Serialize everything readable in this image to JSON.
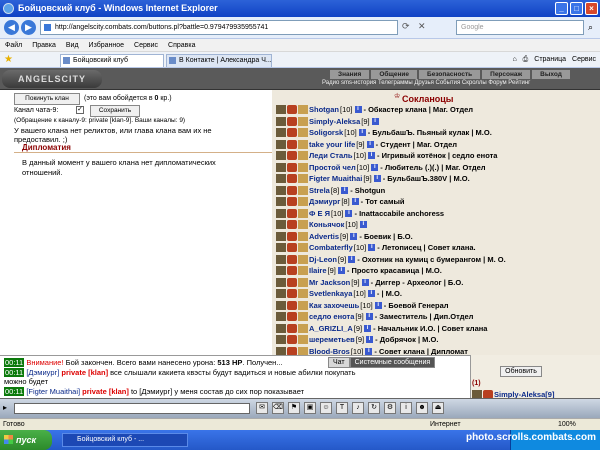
{
  "window": {
    "title": "Бойцовский клуб - Windows Internet Explorer"
  },
  "browser": {
    "url": "http://angelscity.combats.com/buttons.pl?battle=0.979479935955741",
    "search_placeholder": "Google",
    "menu": [
      "Файл",
      "Правка",
      "Вид",
      "Избранное",
      "Сервис",
      "Справка"
    ],
    "tabs": [
      {
        "label": "Бойцовский клуб"
      },
      {
        "label": "В Контакте | Александра Ч..."
      }
    ],
    "tools": [
      "Страница",
      "Сервис"
    ]
  },
  "game": {
    "logo": "ANGELSCITY",
    "menu_top": [
      "Знания",
      "Общение",
      "Безопасность",
      "Персонаж",
      "Выход"
    ],
    "menu_bottom": "Радио  sms-история  Телеграммы  Друзья  События  Скроллы  Форум  Рейтинг"
  },
  "left": {
    "leave_clan_button": "Покинуть клан",
    "cost_note_pre": "(это вам обойдется в",
    "cost_value": "0",
    "cost_note_post": "кр.)",
    "channel_label": "Канал чата-9:",
    "save_button": "Сохранить",
    "channel_hint": "(Обращение к каналу-9: private [klan-9]. Ваши каналы: 9)",
    "relics_text_1": "У вашего клана нет реликтов, или глава клана вам их не",
    "relics_text_2": "предоставил. ;)",
    "diplomacy_title": "Дипломатия",
    "diplomacy_text_1": "В данный момент у вашего клана нет дипломатических",
    "diplomacy_text_2": "отношений."
  },
  "clan": {
    "title": "Сокланоцы",
    "members": [
      {
        "name": "Shotgan",
        "level": "[10]",
        "role": "- Обкастер клана | Маг. Отдел"
      },
      {
        "name": "Simply-Aleksa",
        "level": "[9]",
        "role": ""
      },
      {
        "name": "Soligorsk",
        "level": "[10]",
        "role": "- БульбашЪ. Пьяный кулак | М.О."
      },
      {
        "name": "take your life",
        "level": "[9]",
        "role": "- Студент | Маг. Отдел"
      },
      {
        "name": "Леди Сталь",
        "level": "[10]",
        "role": "- Игривый котёнок | седло енота"
      },
      {
        "name": "Простой чел",
        "level": "[10]",
        "role": "- Любитель (.)(.) | Маг. Отдел"
      },
      {
        "name": "Figter Muaithai",
        "level": "[9]",
        "role": "- БульбашЪ.380V | М.О."
      },
      {
        "name": "Strela",
        "level": "[8]",
        "role": "- Shotgun"
      },
      {
        "name": "Дэмиург",
        "level": "[8]",
        "role": "- Тот самый"
      },
      {
        "name": "Ф Е Я",
        "level": "[10]",
        "role": "- Inattaccabile anchoress"
      },
      {
        "name": "Коньячок",
        "level": "[10]",
        "role": ""
      },
      {
        "name": "Advertis",
        "level": "[9]",
        "role": "- Боевик | Б.О."
      },
      {
        "name": "Combaterfly",
        "level": "[10]",
        "role": "- Летописец | Совет клана."
      },
      {
        "name": "Dj-Leon",
        "level": "[9]",
        "role": "- Охотник на кумиц с бумерангом | М. О."
      },
      {
        "name": "Ilaire",
        "level": "[9]",
        "role": "- Просто красавица | М.О."
      },
      {
        "name": "Mr Jackson",
        "level": "[9]",
        "role": "- Диггер - Археолог | Б.О."
      },
      {
        "name": "Svetlenkaya",
        "level": "[10]",
        "role": "- | М.О."
      },
      {
        "name": "Как захочешь",
        "level": "[10]",
        "role": "- Боевой Генерал"
      },
      {
        "name": "седло енота",
        "level": "[9]",
        "role": "- Заместитель | Дип.Отдел"
      },
      {
        "name": "A_GRIZLI_A",
        "level": "[9]",
        "role": "- Начальник И.О. | Совет клана"
      },
      {
        "name": "шереметьев",
        "level": "[9]",
        "role": "- Добрячок | М.О."
      },
      {
        "name": "Blood-Bros",
        "level": "[10]",
        "role": "- Совет клана | Дипломат"
      }
    ]
  },
  "chat": {
    "tab_chat": "Чат",
    "tab_system": "Системные сообщения",
    "refresh_button": "Обновить",
    "online_count": "(1)",
    "online_user": "Simply-Aleksa[9]",
    "lines": [
      {
        "time": "00:11",
        "warn": "Внимание!",
        "text": " Бой закончен. Всего вами нанесено урона: ",
        "bold": "513 HP",
        "rest": ". Получен..."
      },
      {
        "time": "00:11",
        "pre": "[Дэмиург] ",
        "priv": "private [klan]",
        "text": " все слышали какиета квэсты будут вадиться и новые абилки покупать"
      },
      {
        "time": "",
        "pre": "",
        "priv": "",
        "text": "можно будет"
      },
      {
        "time": "00:11",
        "pre": "[Figter Muaithai] ",
        "priv": "private [klan]",
        "text": " to [Дэмиург] у меня состав до сих пор показывает"
      }
    ]
  },
  "status": {
    "left": "Готово",
    "zone": "Интернет",
    "zoom": "100%"
  },
  "taskbar": {
    "start": "пуск",
    "task": "Бойцовский клуб - ..."
  },
  "watermark": "photo.scrolls.combats.com"
}
